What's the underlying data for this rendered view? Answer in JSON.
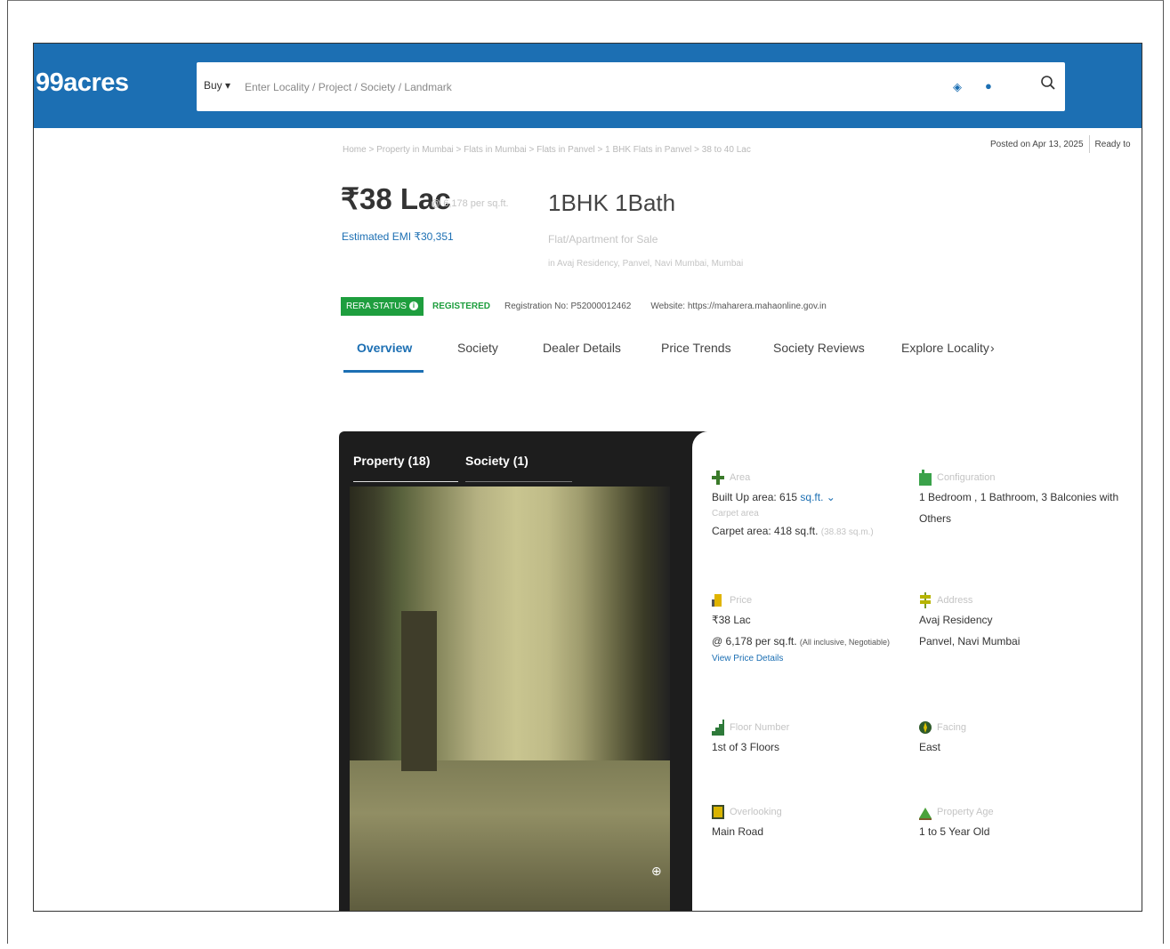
{
  "header": {
    "logo": "99acres",
    "buy_label": "Buy ▾",
    "search_placeholder": "Enter Locality / Project / Society / Landmark"
  },
  "breadcrumb": "Home > Property in Mumbai > Flats in Mumbai > Flats in Panvel > 1 BHK Flats in Panvel > 38 to 40 Lac",
  "posted": {
    "posted_on": "Posted on Apr 13, 2025",
    "status": "Ready to"
  },
  "listing": {
    "price": "₹38 Lac",
    "price_per_sqft": "@ 6,178 per sq.ft.",
    "emi": "Estimated EMI ₹30,351",
    "config": "1BHK 1Bath",
    "type": "Flat/Apartment for Sale",
    "location": "in Avaj Residency, Panvel, Navi Mumbai, Mumbai"
  },
  "rera": {
    "badge": "RERA STATUS",
    "status": "REGISTERED",
    "registration": "Registration No: P52000012462",
    "website": "Website: https://maharera.mahaonline.gov.in"
  },
  "tabs": [
    {
      "label": "Overview"
    },
    {
      "label": "Society"
    },
    {
      "label": "Dealer Details"
    },
    {
      "label": "Price Trends"
    },
    {
      "label": "Society Reviews"
    },
    {
      "label": "Explore Locality"
    }
  ],
  "gallery": {
    "property_tab": "Property (18)",
    "society_tab": "Society (1)"
  },
  "details": {
    "area": {
      "label": "Area",
      "built_up": "Built Up area: 615",
      "unit": "sq.ft. ⌄",
      "carpet_label": "Carpet area",
      "carpet": "Carpet area: 418 sq.ft.",
      "carpet_note": "(38.83 sq.m.)"
    },
    "configuration": {
      "label": "Configuration",
      "value": "1 Bedroom , 1 Bathroom, 3 Balconies with Others"
    },
    "price": {
      "label": "Price",
      "value": "₹38 Lac",
      "per_sqft": "@ 6,178 per sq.ft.",
      "note": "(All inclusive, Negotiable)",
      "link": "View Price Details"
    },
    "address": {
      "label": "Address",
      "line1": "Avaj Residency",
      "line2": "Panvel, Navi Mumbai"
    },
    "floor": {
      "label": "Floor Number",
      "value": "1st of 3 Floors"
    },
    "facing": {
      "label": "Facing",
      "value": "East"
    },
    "overlooking": {
      "label": "Overlooking",
      "value": "Main Road"
    },
    "age": {
      "label": "Property Age",
      "value": "1 to 5 Year Old"
    }
  },
  "colors": {
    "brand_blue": "#1c6fb3",
    "rera_green": "#1e9e3e"
  }
}
